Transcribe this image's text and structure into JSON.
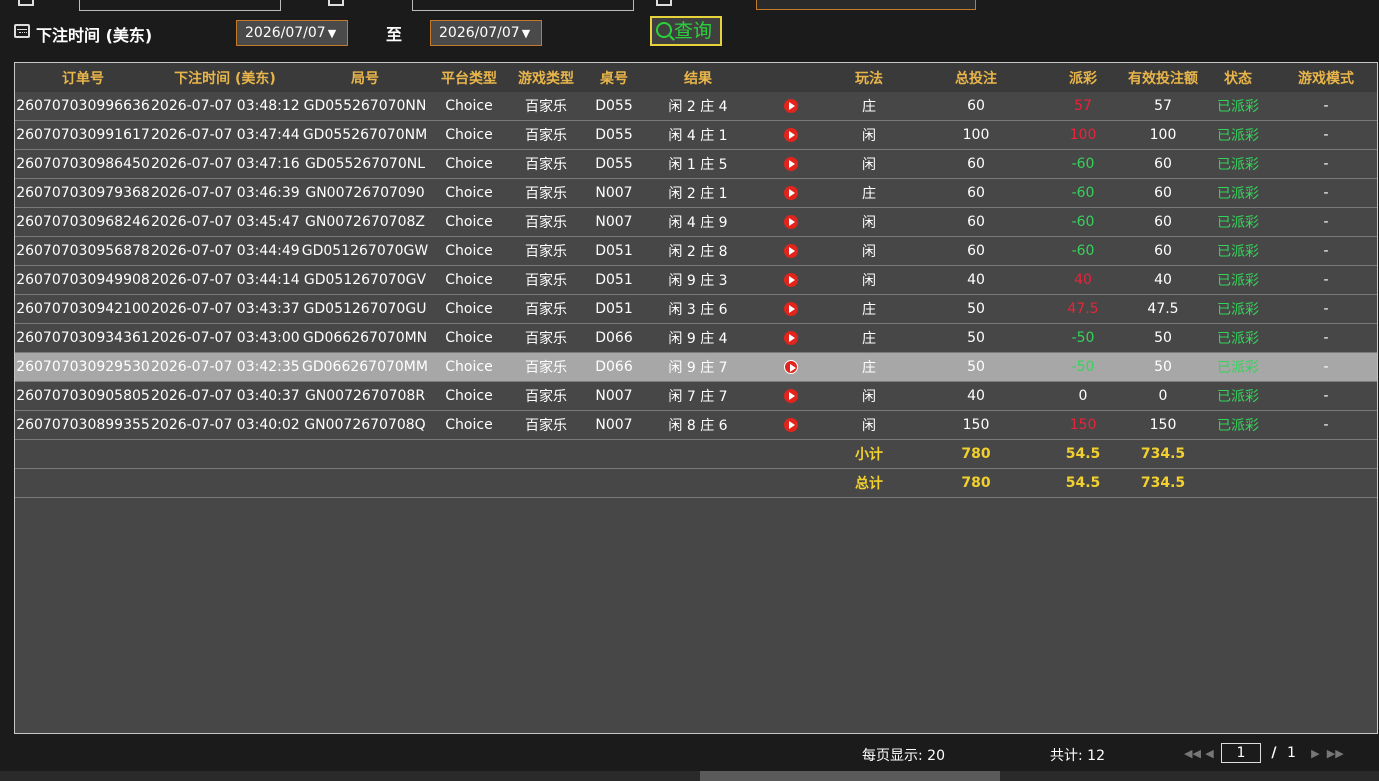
{
  "filters": {
    "bet_time_label": "下注时间 (美东)",
    "date_from": "2026/07/07",
    "date_to": "2026/07/07",
    "to_label": "至",
    "query_label": "查询"
  },
  "columns": [
    "订单号",
    "下注时间 (美东)",
    "局号",
    "平台类型",
    "游戏类型",
    "桌号",
    "结果",
    "",
    "玩法",
    "总投注",
    "派彩",
    "有效投注额",
    "状态",
    "游戏模式"
  ],
  "rows": [
    [
      "260707030996636",
      "2026-07-07 03:48:12",
      "GD055267070NN",
      "Choice",
      "百家乐",
      "D055",
      "闲 2 庄 4",
      "",
      "庄",
      "60",
      "57",
      "57",
      "已派彩",
      "-"
    ],
    [
      "260707030991617",
      "2026-07-07 03:47:44",
      "GD055267070NM",
      "Choice",
      "百家乐",
      "D055",
      "闲 4 庄 1",
      "",
      "闲",
      "100",
      "100",
      "100",
      "已派彩",
      "-"
    ],
    [
      "260707030986450",
      "2026-07-07 03:47:16",
      "GD055267070NL",
      "Choice",
      "百家乐",
      "D055",
      "闲 1 庄 5",
      "",
      "闲",
      "60",
      "-60",
      "60",
      "已派彩",
      "-"
    ],
    [
      "260707030979368",
      "2026-07-07 03:46:39",
      "GN00726707090",
      "Choice",
      "百家乐",
      "N007",
      "闲 2 庄 1",
      "",
      "庄",
      "60",
      "-60",
      "60",
      "已派彩",
      "-"
    ],
    [
      "260707030968246",
      "2026-07-07 03:45:47",
      "GN0072670708Z",
      "Choice",
      "百家乐",
      "N007",
      "闲 4 庄 9",
      "",
      "闲",
      "60",
      "-60",
      "60",
      "已派彩",
      "-"
    ],
    [
      "260707030956878",
      "2026-07-07 03:44:49",
      "GD051267070GW",
      "Choice",
      "百家乐",
      "D051",
      "闲 2 庄 8",
      "",
      "闲",
      "60",
      "-60",
      "60",
      "已派彩",
      "-"
    ],
    [
      "260707030949908",
      "2026-07-07 03:44:14",
      "GD051267070GV",
      "Choice",
      "百家乐",
      "D051",
      "闲 9 庄 3",
      "",
      "闲",
      "40",
      "40",
      "40",
      "已派彩",
      "-"
    ],
    [
      "260707030942100",
      "2026-07-07 03:43:37",
      "GD051267070GU",
      "Choice",
      "百家乐",
      "D051",
      "闲 3 庄 6",
      "",
      "庄",
      "50",
      "47.5",
      "47.5",
      "已派彩",
      "-"
    ],
    [
      "260707030934361",
      "2026-07-07 03:43:00",
      "GD066267070MN",
      "Choice",
      "百家乐",
      "D066",
      "闲 9 庄 4",
      "",
      "庄",
      "50",
      "-50",
      "50",
      "已派彩",
      "-"
    ],
    [
      "260707030929530",
      "2026-07-07 03:42:35",
      "GD066267070MM",
      "Choice",
      "百家乐",
      "D066",
      "闲 9 庄 7",
      "",
      "庄",
      "50",
      "-50",
      "50",
      "已派彩",
      "-"
    ],
    [
      "260707030905805",
      "2026-07-07 03:40:37",
      "GN0072670708R",
      "Choice",
      "百家乐",
      "N007",
      "闲 7 庄 7",
      "",
      "闲",
      "40",
      "0",
      "0",
      "已派彩",
      "-"
    ],
    [
      "260707030899355",
      "2026-07-07 03:40:02",
      "GN0072670708Q",
      "Choice",
      "百家乐",
      "N007",
      "闲 8 庄 6",
      "",
      "闲",
      "150",
      "150",
      "150",
      "已派彩",
      "-"
    ]
  ],
  "summary": {
    "subtotal_label": "小计",
    "subtotal_bet": "780",
    "subtotal_payout": "54.5",
    "subtotal_valid": "734.5",
    "total_label": "总计",
    "total_bet": "780",
    "total_payout": "54.5",
    "total_valid": "734.5"
  },
  "footer": {
    "page_size": "每页显示: 20",
    "total": "共计: 12",
    "page_current": "1",
    "page_sep": "/",
    "page_total": "1"
  },
  "colors": {
    "header_text": "#e8b54a",
    "negative": "#35d35a",
    "positive": "#e8243a",
    "status": "#35d35a",
    "summary": "#f2d02e",
    "accent_border": "#c57a2b"
  },
  "selected_row_index": 9
}
